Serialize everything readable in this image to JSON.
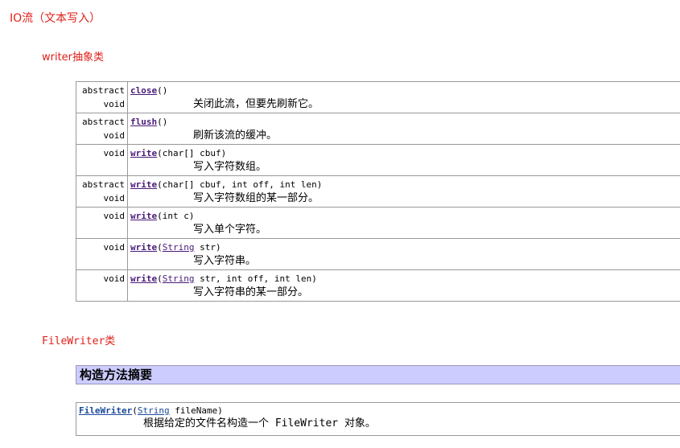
{
  "heading_main": "IO流（文本写入）",
  "heading_writer": "writer抽象类",
  "heading_filewriter": "FileWriter类",
  "methods": [
    {
      "mod1": "abstract",
      "mod2": "void",
      "name": "close",
      "pre": "",
      "type": "",
      "post": "()",
      "desc": "关闭此流，但要先刷新它。"
    },
    {
      "mod1": "abstract",
      "mod2": "void",
      "name": "flush",
      "pre": "",
      "type": "",
      "post": "()",
      "desc": "刷新该流的缓冲。"
    },
    {
      "mod1": "",
      "mod2": "void",
      "name": "write",
      "pre": "",
      "type": "",
      "post": "(char[] cbuf)",
      "desc": "写入字符数组。"
    },
    {
      "mod1": "abstract",
      "mod2": "void",
      "name": "write",
      "pre": "",
      "type": "",
      "post": "(char[] cbuf, int off, int len)",
      "desc": "写入字符数组的某一部分。"
    },
    {
      "mod1": "",
      "mod2": "void",
      "name": "write",
      "pre": "",
      "type": "",
      "post": "(int c)",
      "desc": "写入单个字符。"
    },
    {
      "mod1": "",
      "mod2": "void",
      "name": "write",
      "pre": "(",
      "type": "String",
      "post": " str)",
      "desc": "写入字符串。"
    },
    {
      "mod1": "",
      "mod2": "void",
      "name": "write",
      "pre": "(",
      "type": "String",
      "post": " str, int off, int len)",
      "desc": "写入字符串的某一部分。"
    }
  ],
  "summary": {
    "title": "构造方法摘要",
    "ctor_name": "FileWriter",
    "ctor_pre": "(",
    "ctor_type": "String",
    "ctor_post": " fileName)",
    "ctor_desc": "根据给定的文件名构造一个 FileWriter 对象。"
  }
}
